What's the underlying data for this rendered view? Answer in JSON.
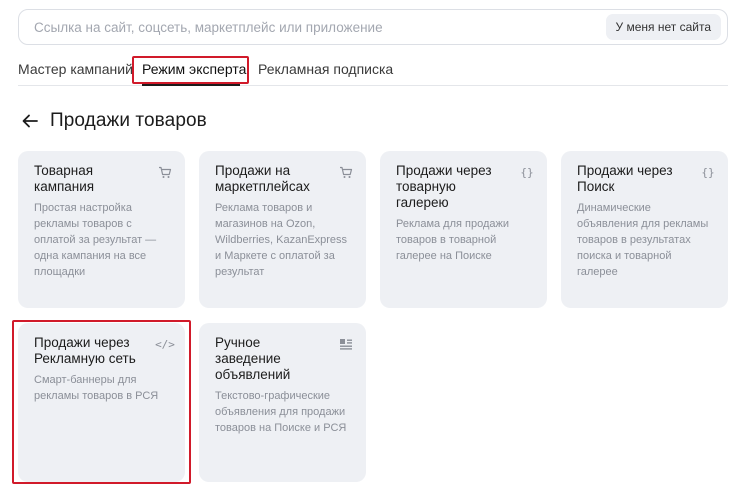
{
  "search": {
    "placeholder": "Ссылка на сайт, соцсеть, маркетплейс или приложение",
    "no_site_button": "У меня нет сайта"
  },
  "tabs": [
    {
      "label": "Мастер кампаний",
      "active": false
    },
    {
      "label": "Режим эксперта",
      "active": true
    },
    {
      "label": "Рекламная подписка",
      "active": false
    }
  ],
  "page": {
    "title": "Продажи товаров",
    "back_icon": "arrow-left-icon"
  },
  "cards": [
    {
      "title": "Товарная кампания",
      "description": "Простая настройка рекламы товаров с оплатой за результат — одна кампания на все площадки",
      "icon": "cart-icon"
    },
    {
      "title": "Продажи на маркетплейсах",
      "description": "Реклама товаров и магазинов на Ozon, Wildberries, KazanExpress и Маркете с оплатой за результат",
      "icon": "cart-icon"
    },
    {
      "title": "Продажи через товарную галерею",
      "description": "Реклама для продажи товаров в товарной галерее на Поиске",
      "icon": "braces-icon"
    },
    {
      "title": "Продажи через Поиск",
      "description": "Динамические объявления для рекламы товаров в результатах поиска и товарной галерее",
      "icon": "braces-icon"
    },
    {
      "title": "Продажи через Рекламную сеть",
      "description": "Смарт-баннеры для рекламы товаров в РСЯ",
      "icon": "code-icon"
    },
    {
      "title": "Ручное заведение объявлений",
      "description": "Текстово-графические объявления для продажи товаров на Поиске и РСЯ",
      "icon": "list-icon"
    }
  ],
  "colors": {
    "highlight": "#d11a2a",
    "card_bg": "#eef0f4",
    "muted_text": "#8b8f98"
  }
}
